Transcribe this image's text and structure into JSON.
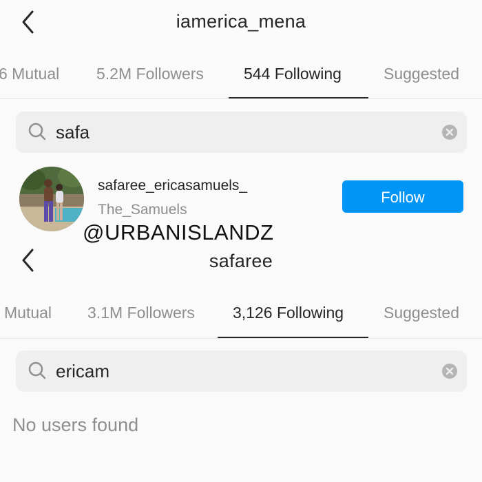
{
  "screen1": {
    "title": "iamerica_mena",
    "tabs": [
      {
        "label": "6 Mutual",
        "active": false
      },
      {
        "label": "5.2M Followers",
        "active": false
      },
      {
        "label": "544 Following",
        "active": true
      },
      {
        "label": "Suggested",
        "active": false
      }
    ],
    "search": {
      "value": "safa",
      "icon": "search-icon",
      "clear_icon": "clear-icon"
    },
    "result": {
      "username": "safaree_ericasamuels_",
      "full_name": "The_Samuels",
      "follow_label": "Follow"
    }
  },
  "watermark": "@URBANISLANDZ",
  "screen2": {
    "title": "safaree",
    "tabs": [
      {
        "label": "Mutual",
        "active": false
      },
      {
        "label": "3.1M Followers",
        "active": false
      },
      {
        "label": "3,126 Following",
        "active": true
      },
      {
        "label": "Suggested",
        "active": false
      }
    ],
    "search": {
      "value": "ericam",
      "icon": "search-icon",
      "clear_icon": "clear-icon"
    },
    "empty_message": "No users found"
  },
  "colors": {
    "accent": "#0095f6",
    "text": "#262626",
    "muted": "#8e8e8e",
    "search_bg": "#efefef",
    "page_bg": "#fafafa"
  }
}
